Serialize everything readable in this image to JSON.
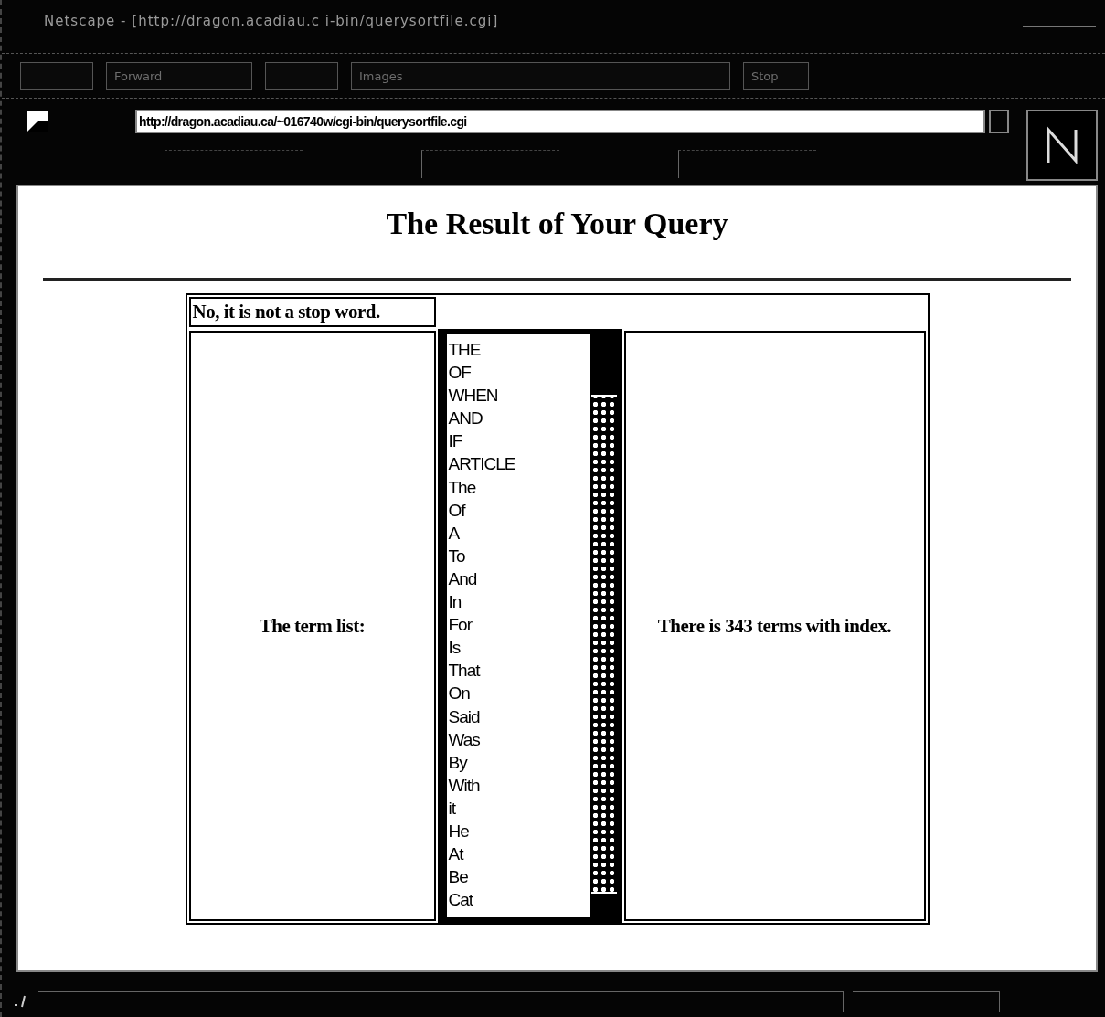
{
  "window": {
    "title": "Netscape - [http://dragon.acadiau.c   i-bin/querysortfile.cgi]"
  },
  "toolbar": {
    "buttons": [
      "Forward",
      "Images",
      "Stop"
    ]
  },
  "location": {
    "url": "http://dragon.acadiau.ca/~016740w/cgi-bin/querysortfile.cgi"
  },
  "page": {
    "heading": "The Result of Your Query",
    "message": "No, it is not a stop word.",
    "term_label": "The term list:",
    "count_text": "There is 343 terms with index.",
    "terms": [
      "THE",
      "OF",
      "WHEN",
      "AND",
      "IF",
      "ARTICLE",
      "The",
      "Of",
      "A",
      "To",
      "And",
      "In",
      "For",
      "Is",
      "That",
      "On",
      "Said",
      "Was",
      "By",
      "With",
      "it",
      "He",
      "At",
      "Be",
      "Cat"
    ]
  }
}
